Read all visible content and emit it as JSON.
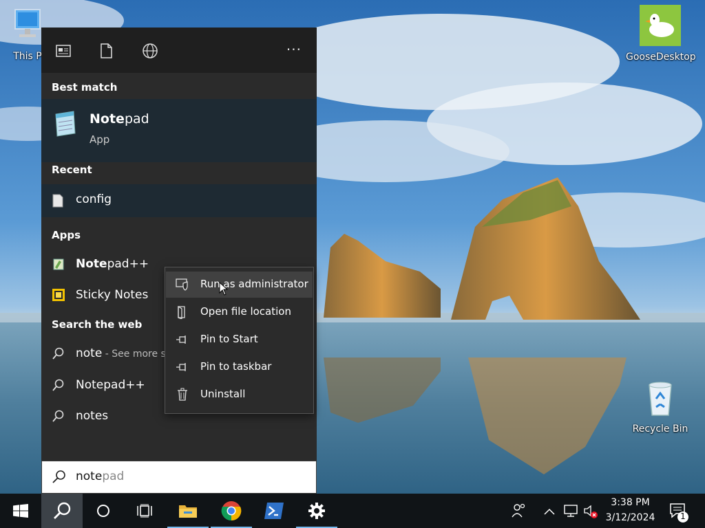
{
  "desktop": {
    "icons": {
      "this_pc": "This P",
      "goose": "GooseDesktop",
      "recycle": "Recycle Bin"
    }
  },
  "search_panel": {
    "top_icons": [
      "documents-view-icon",
      "document-icon",
      "globe-icon"
    ],
    "more_label": "···",
    "best_match": {
      "heading": "Best match",
      "title_bold": "Note",
      "title_rest": "pad",
      "subtitle": "App"
    },
    "recent": {
      "heading": "Recent",
      "item": "config"
    },
    "apps": {
      "heading": "Apps",
      "items": [
        {
          "bold": "Note",
          "rest": "pad++"
        },
        {
          "bold": "Sticky Notes",
          "rest": ""
        }
      ]
    },
    "web": {
      "heading": "Search the web",
      "items": [
        {
          "bold": "note",
          "rest": "",
          "sub": " - See more s"
        },
        {
          "bold": "Notepad++",
          "rest": "",
          "sub": ""
        },
        {
          "bold": "notes",
          "rest": "",
          "sub": ""
        }
      ]
    },
    "query": {
      "typed": "note",
      "hint": "pad"
    }
  },
  "context_menu": {
    "items": [
      {
        "label": "Run as administrator",
        "icon": "shield-icon"
      },
      {
        "label": "Open file location",
        "icon": "folder-location-icon"
      },
      {
        "label": "Pin to Start",
        "icon": "pin-icon"
      },
      {
        "label": "Pin to taskbar",
        "icon": "pin-icon"
      },
      {
        "label": "Uninstall",
        "icon": "trash-icon"
      }
    ]
  },
  "taskbar": {
    "clock_time": "3:38 PM",
    "clock_date": "3/12/2024",
    "notification_count": "1"
  },
  "colors": {
    "panel_bg": "#2b2b2b",
    "highlight_bg": "#1e2a33",
    "taskbar_bg": "#101417",
    "accent": "#76b9ed"
  }
}
